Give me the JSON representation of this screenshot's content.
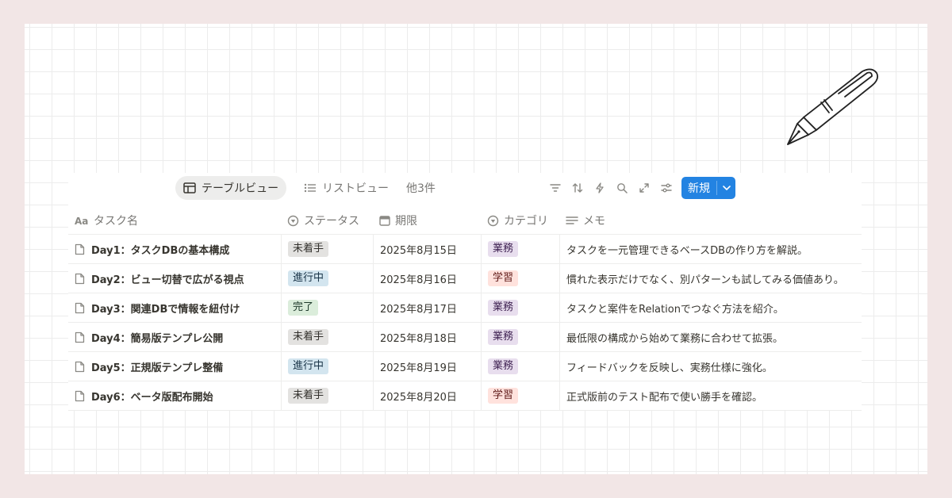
{
  "view_tabs": [
    {
      "label": "テーブルビュー",
      "active": true
    },
    {
      "label": "リストビュー",
      "active": false
    },
    {
      "label": "他3件",
      "active": false
    }
  ],
  "toolbar": {
    "tools": [
      "filter-icon",
      "sort-icon",
      "automation-icon",
      "search-icon",
      "expand-icon",
      "settings-icon"
    ],
    "new_label": "新規",
    "accent": "#2383e2"
  },
  "columns": [
    {
      "label": "タスク名",
      "icon": "title-icon"
    },
    {
      "label": "ステータス",
      "icon": "status-icon"
    },
    {
      "label": "期限",
      "icon": "calendar-icon"
    },
    {
      "label": "カテゴリ",
      "icon": "select-icon"
    },
    {
      "label": "メモ",
      "icon": "text-icon"
    }
  ],
  "rows": [
    {
      "name": "Day1：タスクDBの基本構成",
      "status": "未着手",
      "due": "2025年8月15日",
      "category": "業務",
      "memo": "タスクを一元管理できるベースDBの作り方を解説。"
    },
    {
      "name": "Day2：ビュー切替で広がる視点",
      "status": "進行中",
      "due": "2025年8月16日",
      "category": "学習",
      "memo": "慣れた表示だけでなく、別パターンも試してみる価値あり。"
    },
    {
      "name": "Day3：関連DBで情報を紐付け",
      "status": "完了",
      "due": "2025年8月17日",
      "category": "業務",
      "memo": "タスクと案件をRelationでつなぐ方法を紹介。"
    },
    {
      "name": "Day4：簡易版テンプレ公開",
      "status": "未着手",
      "due": "2025年8月18日",
      "category": "業務",
      "memo": "最低限の構成から始めて業務に合わせて拡張。"
    },
    {
      "name": "Day5：正規版テンプレ整備",
      "status": "進行中",
      "due": "2025年8月19日",
      "category": "業務",
      "memo": "フィードバックを反映し、実務仕様に強化。"
    },
    {
      "name": "Day6：ベータ版配布開始",
      "status": "未着手",
      "due": "2025年8月20日",
      "category": "学習",
      "memo": "正式版前のテスト配布で使い勝手を確認。"
    }
  ],
  "status_colors": {
    "未着手": {
      "bg": "#e3e2e0",
      "fg": "#32302c"
    },
    "進行中": {
      "bg": "#d3e5ef",
      "fg": "#183347"
    },
    "完了": {
      "bg": "#dbeddb",
      "fg": "#1c3829"
    }
  },
  "category_colors": {
    "業務": {
      "bg": "#e8deee",
      "fg": "#412454"
    },
    "学習": {
      "bg": "#ffe2dd",
      "fg": "#5d1715"
    }
  }
}
